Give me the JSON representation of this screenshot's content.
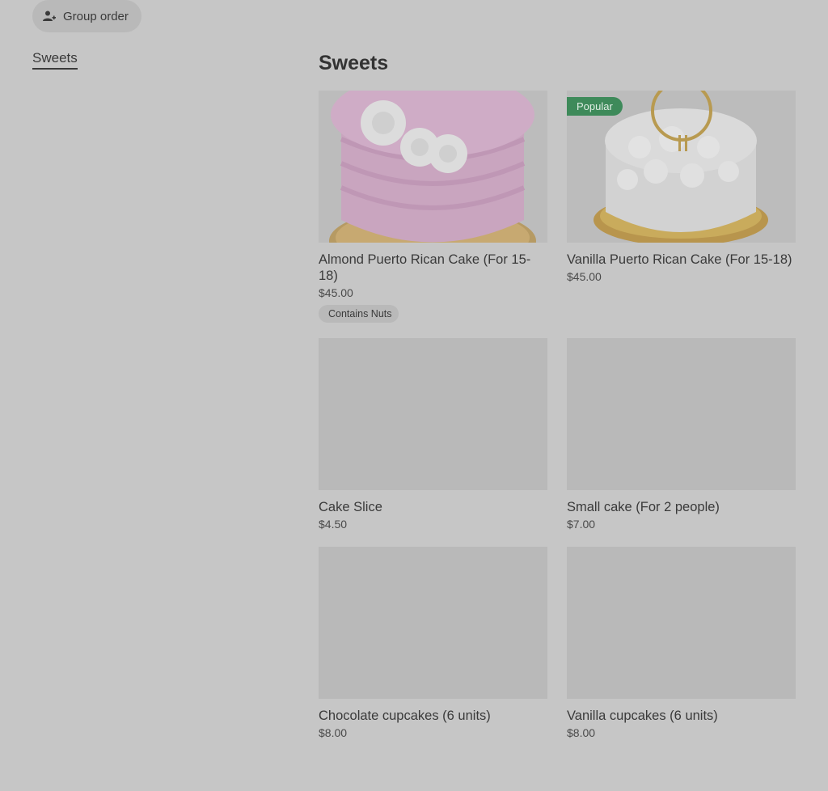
{
  "header": {
    "group_order_label": "Group order"
  },
  "sidebar": {
    "items": [
      {
        "label": "Sweets"
      }
    ]
  },
  "section": {
    "title": "Sweets"
  },
  "items": [
    {
      "name": "Almond Puerto Rican Cake (For 15-18)",
      "price": "$45.00",
      "tag": "Contains Nuts"
    },
    {
      "name": "Vanilla Puerto Rican Cake (For 15-18)",
      "price": "$45.00",
      "badge": "Popular"
    },
    {
      "name": "Cake Slice",
      "price": "$4.50"
    },
    {
      "name": "Small cake (For 2 people)",
      "price": "$7.00"
    },
    {
      "name": "Chocolate cupcakes (6 units)",
      "price": "$8.00"
    },
    {
      "name": "Vanilla cupcakes (6 units)",
      "price": "$8.00"
    }
  ]
}
